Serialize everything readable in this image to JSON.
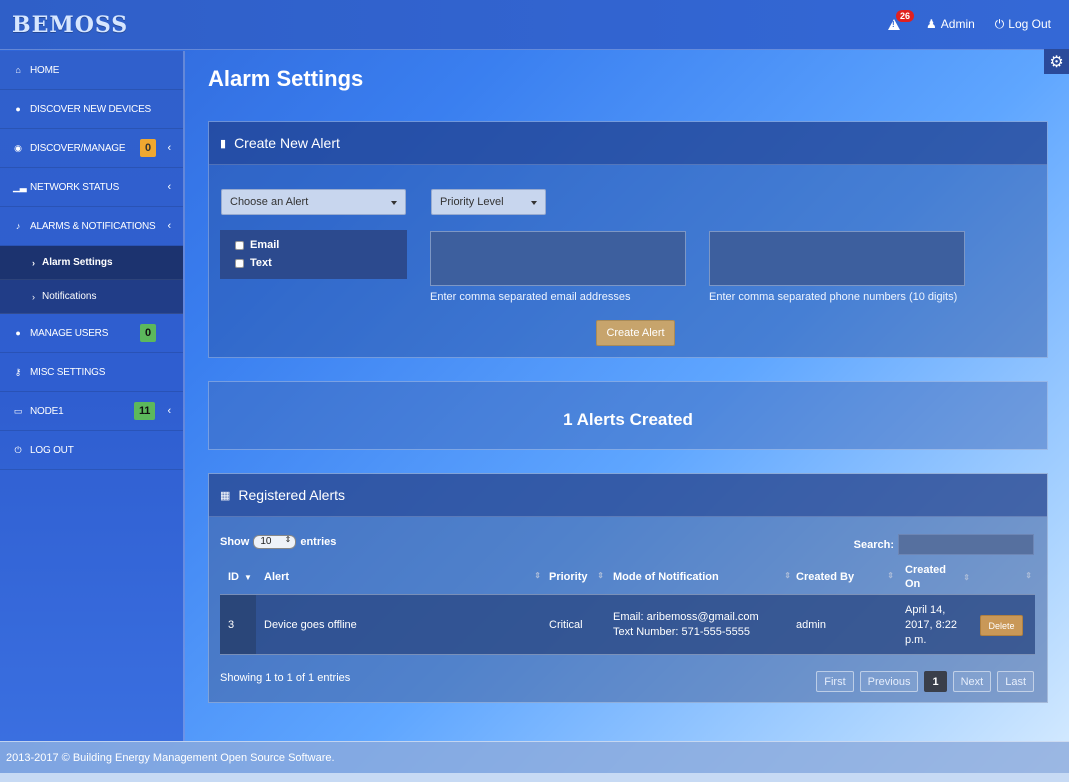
{
  "brand": "BEMOSS",
  "topnav": {
    "alert_count": "26",
    "admin": "Admin",
    "logout": "Log Out"
  },
  "sidebar": {
    "items": [
      {
        "label": "HOME",
        "icon": "home-icon"
      },
      {
        "label": "DISCOVER NEW DEVICES",
        "icon": "user-icon"
      },
      {
        "label": "DISCOVER/MANAGE",
        "icon": "globe-icon",
        "badge": "0"
      },
      {
        "label": "NETWORK STATUS",
        "icon": "signal-icon"
      },
      {
        "label": "ALARMS & NOTIFICATIONS",
        "icon": "bell-icon"
      },
      {
        "label": "MANAGE USERS",
        "icon": "user-icon",
        "badge": "0"
      },
      {
        "label": "MISC SETTINGS",
        "icon": "key-icon"
      },
      {
        "label": "NODE1",
        "icon": "monitor-icon",
        "badge": "11"
      },
      {
        "label": "LOG OUT",
        "icon": "power-icon"
      }
    ],
    "sub_items": [
      {
        "label": "Alarm Settings"
      },
      {
        "label": "Notifications"
      }
    ],
    "badge_colors": {
      "orange": "#f0a830",
      "green": "#5cb85c"
    }
  },
  "page": {
    "title": "Alarm Settings"
  },
  "create_alert": {
    "heading": "Create New Alert",
    "choose_alert": "Choose an Alert",
    "priority_level": "Priority Level",
    "email_label": "Email",
    "text_label": "Text",
    "email_help": "Enter comma separated email addresses",
    "phone_help": "Enter comma separated phone numbers (10 digits)",
    "button": "Create Alert"
  },
  "alerts_count": "1 Alerts Created",
  "registered": {
    "heading": "Registered Alerts",
    "show": "Show",
    "entries_value": "10",
    "entries": "entries",
    "search": "Search:",
    "columns": [
      "ID",
      "Alert",
      "Priority",
      "Mode of Notification",
      "Created By",
      "Created On"
    ],
    "rows": [
      {
        "id": "3",
        "alert": "Device goes offline",
        "priority": "Critical",
        "mode_line1": "Email: aribemoss@gmail.com",
        "mode_line2": "Text Number: 571-555-5555",
        "created_by": "admin",
        "created_on_line1": "April 14,",
        "created_on_line2": "2017, 8:22",
        "created_on_line3": "p.m.",
        "action": "Delete"
      }
    ],
    "info": "Showing 1 to 1 of 1 entries",
    "pager": [
      "First",
      "Previous",
      "1",
      "Next",
      "Last"
    ]
  },
  "footer": "2013-2017 © Building Energy Management Open Source Software."
}
